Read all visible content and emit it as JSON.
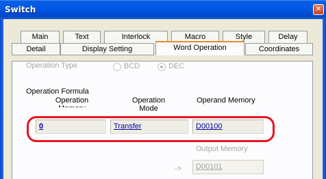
{
  "window": {
    "title": "Switch",
    "close_glyph": "✕"
  },
  "tabs_row1": [
    {
      "label": "Main"
    },
    {
      "label": "Text"
    },
    {
      "label": "Interlock"
    },
    {
      "label": "Macro"
    },
    {
      "label": "Style"
    },
    {
      "label": "Delay"
    }
  ],
  "tabs_row2": [
    {
      "label": "Detail"
    },
    {
      "label": "Display Setting"
    },
    {
      "label": "Word Operation",
      "selected": true
    },
    {
      "label": "Coordinates"
    }
  ],
  "operation_type": {
    "label": "Operation Type",
    "options": [
      {
        "label": "BCD",
        "selected": false
      },
      {
        "label": "DEC",
        "selected": true
      }
    ]
  },
  "formula": {
    "label": "Operation Formula",
    "col_operation_memory": "Operation Memory",
    "col_operation_mode": "Operation Mode",
    "col_operand_memory": "Operand Memory",
    "operation_memory_value": "0",
    "operation_mode_value": "Transfer",
    "operand_memory_value": "D00100"
  },
  "output": {
    "label": "Output Memory",
    "arrow": "->",
    "value": "D00101"
  },
  "colors": {
    "accent_tab": "#e68b2c",
    "highlight": "#e8101e",
    "link": "#0000a0"
  }
}
